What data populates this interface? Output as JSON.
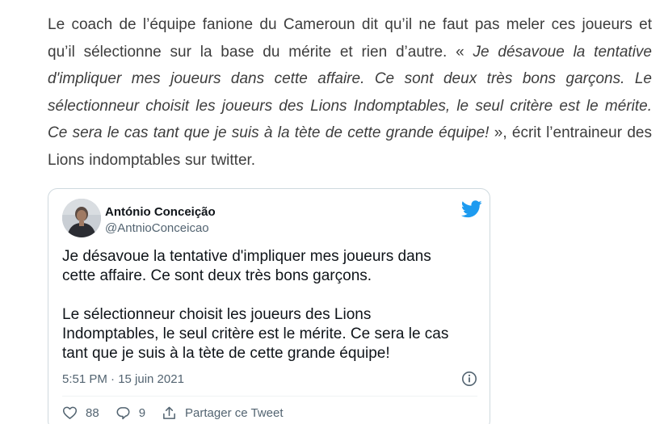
{
  "article": {
    "lead": "Le coach de l’équipe fanione du Cameroun dit qu’il ne faut pas meler ces joueurs et qu’il sélectionne sur la base du mérite et rien d’autre. « ",
    "quote": "Je désavoue la tentative d'impliquer mes joueurs dans cette affaire. Ce sont deux très bons garçons. Le sélectionneur choisit les joueurs des Lions Indomptables, le seul critère est le mérite. Ce sera le cas tant que je suis à la tète de cette grande équipe!",
    "tail": " », écrit l’entraineur des Lions indomptables sur twitter."
  },
  "tweet": {
    "author_name": "António Conceição",
    "author_handle": "@AntnioConceicao",
    "paragraphs": [
      "Je désavoue la tentative d'impliquer mes joueurs dans cette affaire. Ce sont deux très bons garçons.",
      "Le sélectionneur choisit les joueurs des Lions Indomptables, le seul critère est le mérite. Ce sera le cas tant que je suis à la tète de cette grande équipe!"
    ],
    "timestamp": "5:51 PM · 15 juin 2021",
    "likes": "88",
    "replies": "9",
    "share_label": "Partager ce Tweet"
  },
  "icons": {
    "brand": "twitter-bird-icon",
    "info": "info-icon",
    "like": "heart-icon",
    "reply": "reply-bubble-icon",
    "share": "share-icon"
  },
  "colors": {
    "twitter_blue": "#1d9bf0",
    "text_primary": "#0f1419",
    "text_secondary": "#536471",
    "article_text": "#3d3d3d",
    "card_border": "#cfd9de"
  }
}
